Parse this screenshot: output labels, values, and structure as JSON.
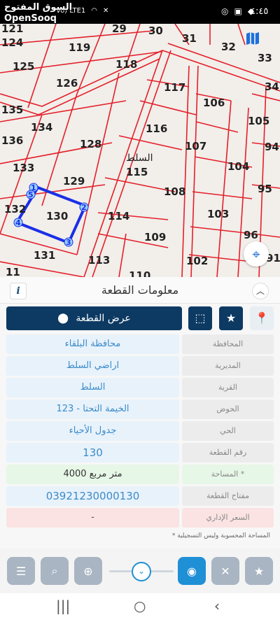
{
  "status_bar": {
    "time": "٤:٤٥",
    "network_label": "Vo) LTE1"
  },
  "watermark": {
    "arabic": "السوق المفتوح",
    "english": "OpenSooq"
  },
  "map": {
    "area_label": "السلط",
    "selected_parcel": "130",
    "selected_color": "#1a2fe6",
    "boundary_color": "#e4202a",
    "vertex_labels": [
      "1",
      "2",
      "3",
      "4",
      "5"
    ],
    "parcels": [
      {
        "id": "121"
      },
      {
        "id": "124"
      },
      {
        "id": "125"
      },
      {
        "id": "135"
      },
      {
        "id": "136"
      },
      {
        "id": "133"
      },
      {
        "id": "132"
      },
      {
        "id": "131"
      },
      {
        "id": "11"
      },
      {
        "id": "29"
      },
      {
        "id": "30"
      },
      {
        "id": "31"
      },
      {
        "id": "32"
      },
      {
        "id": "33"
      },
      {
        "id": "34"
      },
      {
        "id": "119"
      },
      {
        "id": "118"
      },
      {
        "id": "126"
      },
      {
        "id": "117"
      },
      {
        "id": "106"
      },
      {
        "id": "134"
      },
      {
        "id": "116"
      },
      {
        "id": "105"
      },
      {
        "id": "128"
      },
      {
        "id": "107"
      },
      {
        "id": "94"
      },
      {
        "id": "115"
      },
      {
        "id": "104"
      },
      {
        "id": "129"
      },
      {
        "id": "108"
      },
      {
        "id": "95"
      },
      {
        "id": "130"
      },
      {
        "id": "114"
      },
      {
        "id": "103"
      },
      {
        "id": "96"
      },
      {
        "id": "109"
      },
      {
        "id": "113"
      },
      {
        "id": "102"
      },
      {
        "id": "91"
      },
      {
        "id": "110"
      }
    ]
  },
  "panel": {
    "title": "معلومات القطعة",
    "info_label": "i",
    "show_parcel_label": "عرض القطعة",
    "rows": [
      {
        "label": "المحافظة",
        "value": "محافظة البلقاء"
      },
      {
        "label": "المديرية",
        "value": "اراضي السلط"
      },
      {
        "label": "القرية",
        "value": "السلط"
      },
      {
        "label": "الحوض",
        "value": "الخيمة التحتا - 123"
      },
      {
        "label": "الحي",
        "value": "جدول الأحياء"
      },
      {
        "label": "رقم القطعة",
        "value": "130"
      },
      {
        "label": "المساحة *",
        "value": "4000  متر مربع"
      },
      {
        "label": "مفتاح القطعة",
        "value": "03921230000130"
      },
      {
        "label": "السعر الإداري",
        "value": "-"
      }
    ],
    "footnote": "* المساحة المحسوبة وليس التسجيلية"
  },
  "toolbar": {
    "items": [
      "list-icon",
      "search-icon",
      "add-location-icon",
      "chevron-down-icon",
      "location-pin-icon",
      "tools-icon",
      "star-icon"
    ]
  },
  "nav_bar": {
    "recents_label": "|||",
    "home_label": "○",
    "back_label": "‹"
  }
}
